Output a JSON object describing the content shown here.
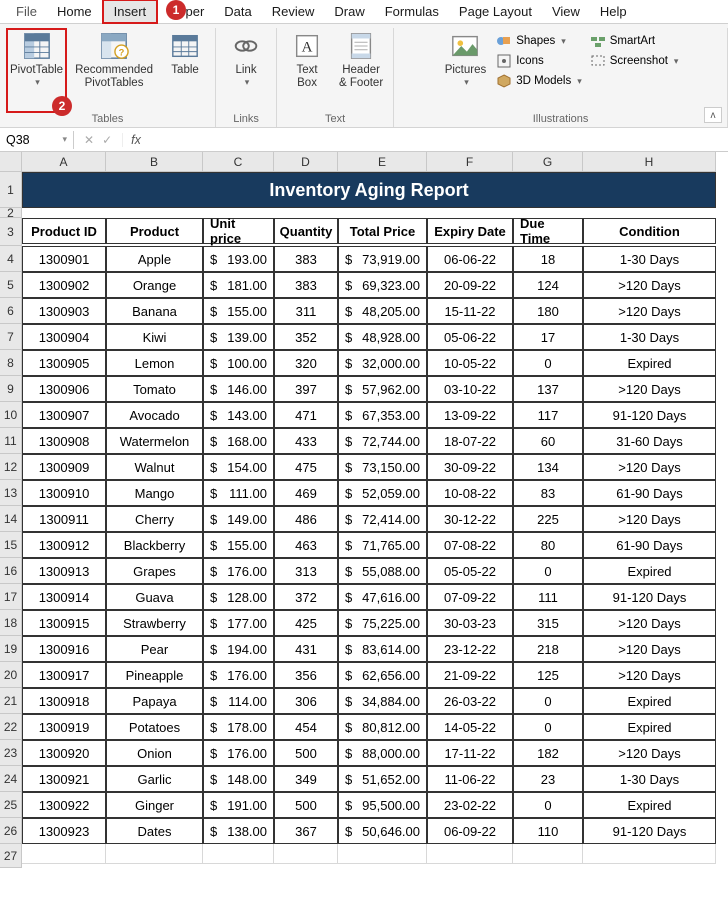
{
  "menu": {
    "items": [
      "File",
      "Home",
      "Insert",
      "eloper",
      "Data",
      "Review",
      "Draw",
      "Formulas",
      "Page Layout",
      "View",
      "Help"
    ],
    "highlighted_index": 2
  },
  "annotations": {
    "badge1": "1",
    "badge2": "2"
  },
  "ribbon": {
    "pivot": "PivotTable",
    "recommended": "Recommended\nPivotTables",
    "table": "Table",
    "group_tables": "Tables",
    "link": "Link",
    "group_links": "Links",
    "textbox": "Text\nBox",
    "header": "Header\n& Footer",
    "group_text": "Text",
    "pictures": "Pictures",
    "shapes": "Shapes",
    "icons": "Icons",
    "models": "3D Models",
    "smartart": "SmartArt",
    "screenshot": "Screenshot",
    "group_illus": "Illustrations"
  },
  "namebox": "Q38",
  "fx": "fx",
  "columns": [
    "A",
    "B",
    "C",
    "D",
    "E",
    "F",
    "G",
    "H"
  ],
  "title": "Inventory Aging Report",
  "headers": [
    "Product ID",
    "Product",
    "Unit price",
    "Quantity",
    "Total Price",
    "Expiry Date",
    "Due Time",
    "Condition"
  ],
  "rows": [
    {
      "id": "1300901",
      "product": "Apple",
      "unit": "193.00",
      "qty": "383",
      "total": "73,919.00",
      "expiry": "06-06-22",
      "due": "18",
      "cond": "1-30 Days"
    },
    {
      "id": "1300902",
      "product": "Orange",
      "unit": "181.00",
      "qty": "383",
      "total": "69,323.00",
      "expiry": "20-09-22",
      "due": "124",
      "cond": ">120 Days"
    },
    {
      "id": "1300903",
      "product": "Banana",
      "unit": "155.00",
      "qty": "311",
      "total": "48,205.00",
      "expiry": "15-11-22",
      "due": "180",
      "cond": ">120 Days"
    },
    {
      "id": "1300904",
      "product": "Kiwi",
      "unit": "139.00",
      "qty": "352",
      "total": "48,928.00",
      "expiry": "05-06-22",
      "due": "17",
      "cond": "1-30 Days"
    },
    {
      "id": "1300905",
      "product": "Lemon",
      "unit": "100.00",
      "qty": "320",
      "total": "32,000.00",
      "expiry": "10-05-22",
      "due": "0",
      "cond": "Expired"
    },
    {
      "id": "1300906",
      "product": "Tomato",
      "unit": "146.00",
      "qty": "397",
      "total": "57,962.00",
      "expiry": "03-10-22",
      "due": "137",
      "cond": ">120 Days"
    },
    {
      "id": "1300907",
      "product": "Avocado",
      "unit": "143.00",
      "qty": "471",
      "total": "67,353.00",
      "expiry": "13-09-22",
      "due": "117",
      "cond": "91-120 Days"
    },
    {
      "id": "1300908",
      "product": "Watermelon",
      "unit": "168.00",
      "qty": "433",
      "total": "72,744.00",
      "expiry": "18-07-22",
      "due": "60",
      "cond": "31-60 Days"
    },
    {
      "id": "1300909",
      "product": "Walnut",
      "unit": "154.00",
      "qty": "475",
      "total": "73,150.00",
      "expiry": "30-09-22",
      "due": "134",
      "cond": ">120 Days"
    },
    {
      "id": "1300910",
      "product": "Mango",
      "unit": "111.00",
      "qty": "469",
      "total": "52,059.00",
      "expiry": "10-08-22",
      "due": "83",
      "cond": "61-90 Days"
    },
    {
      "id": "1300911",
      "product": "Cherry",
      "unit": "149.00",
      "qty": "486",
      "total": "72,414.00",
      "expiry": "30-12-22",
      "due": "225",
      "cond": ">120 Days"
    },
    {
      "id": "1300912",
      "product": "Blackberry",
      "unit": "155.00",
      "qty": "463",
      "total": "71,765.00",
      "expiry": "07-08-22",
      "due": "80",
      "cond": "61-90 Days"
    },
    {
      "id": "1300913",
      "product": "Grapes",
      "unit": "176.00",
      "qty": "313",
      "total": "55,088.00",
      "expiry": "05-05-22",
      "due": "0",
      "cond": "Expired"
    },
    {
      "id": "1300914",
      "product": "Guava",
      "unit": "128.00",
      "qty": "372",
      "total": "47,616.00",
      "expiry": "07-09-22",
      "due": "111",
      "cond": "91-120 Days"
    },
    {
      "id": "1300915",
      "product": "Strawberry",
      "unit": "177.00",
      "qty": "425",
      "total": "75,225.00",
      "expiry": "30-03-23",
      "due": "315",
      "cond": ">120 Days"
    },
    {
      "id": "1300916",
      "product": "Pear",
      "unit": "194.00",
      "qty": "431",
      "total": "83,614.00",
      "expiry": "23-12-22",
      "due": "218",
      "cond": ">120 Days"
    },
    {
      "id": "1300917",
      "product": "Pineapple",
      "unit": "176.00",
      "qty": "356",
      "total": "62,656.00",
      "expiry": "21-09-22",
      "due": "125",
      "cond": ">120 Days"
    },
    {
      "id": "1300918",
      "product": "Papaya",
      "unit": "114.00",
      "qty": "306",
      "total": "34,884.00",
      "expiry": "26-03-22",
      "due": "0",
      "cond": "Expired"
    },
    {
      "id": "1300919",
      "product": "Potatoes",
      "unit": "178.00",
      "qty": "454",
      "total": "80,812.00",
      "expiry": "14-05-22",
      "due": "0",
      "cond": "Expired"
    },
    {
      "id": "1300920",
      "product": "Onion",
      "unit": "176.00",
      "qty": "500",
      "total": "88,000.00",
      "expiry": "17-11-22",
      "due": "182",
      "cond": ">120 Days"
    },
    {
      "id": "1300921",
      "product": "Garlic",
      "unit": "148.00",
      "qty": "349",
      "total": "51,652.00",
      "expiry": "11-06-22",
      "due": "23",
      "cond": "1-30 Days"
    },
    {
      "id": "1300922",
      "product": "Ginger",
      "unit": "191.00",
      "qty": "500",
      "total": "95,500.00",
      "expiry": "23-02-22",
      "due": "0",
      "cond": "Expired"
    },
    {
      "id": "1300923",
      "product": "Dates",
      "unit": "138.00",
      "qty": "367",
      "total": "50,646.00",
      "expiry": "06-09-22",
      "due": "110",
      "cond": "91-120 Days"
    }
  ],
  "first_row_num": 1,
  "data_start_row": 4,
  "last_row": 27,
  "chart_data": {
    "type": "table",
    "title": "Inventory Aging Report",
    "columns": [
      "Product ID",
      "Product",
      "Unit price",
      "Quantity",
      "Total Price",
      "Expiry Date",
      "Due Time",
      "Condition"
    ]
  }
}
